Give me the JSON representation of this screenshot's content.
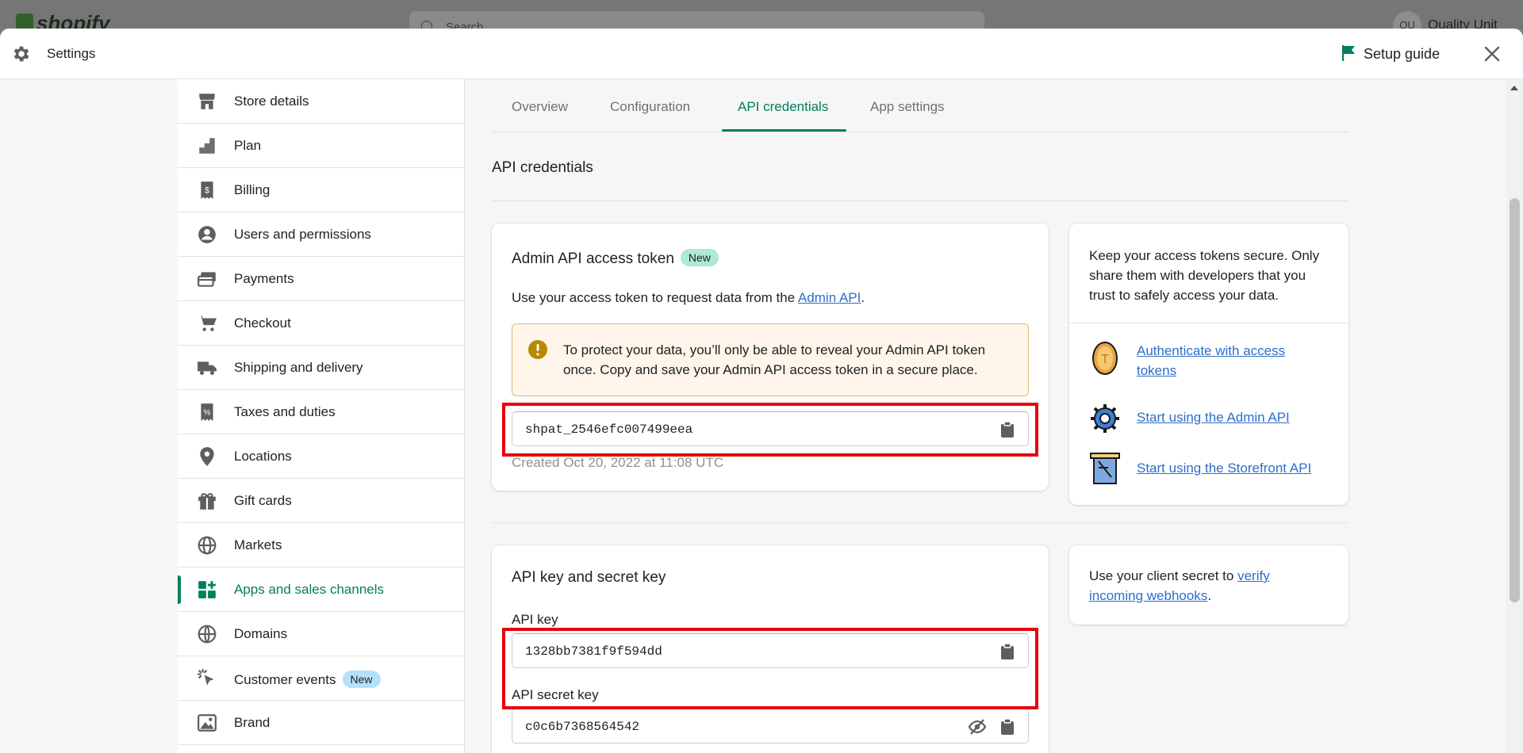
{
  "backdrop": {
    "logo": "shopify",
    "search_placeholder": "Search",
    "user_initials": "QU",
    "user_name": "Quality Unit"
  },
  "modal": {
    "title": "Settings",
    "setup_guide": "Setup guide"
  },
  "sidebar": {
    "items": [
      {
        "label": "Store details",
        "icon": "store-icon"
      },
      {
        "label": "Plan",
        "icon": "plan-icon"
      },
      {
        "label": "Billing",
        "icon": "billing-icon"
      },
      {
        "label": "Users and permissions",
        "icon": "user-icon"
      },
      {
        "label": "Payments",
        "icon": "payments-icon"
      },
      {
        "label": "Checkout",
        "icon": "cart-icon"
      },
      {
        "label": "Shipping and delivery",
        "icon": "truck-icon"
      },
      {
        "label": "Taxes and duties",
        "icon": "tax-icon"
      },
      {
        "label": "Locations",
        "icon": "location-icon"
      },
      {
        "label": "Gift cards",
        "icon": "gift-icon"
      },
      {
        "label": "Markets",
        "icon": "globe-icon"
      },
      {
        "label": "Apps and sales channels",
        "icon": "apps-icon",
        "active": true
      },
      {
        "label": "Domains",
        "icon": "domains-icon"
      },
      {
        "label": "Customer events",
        "icon": "cursor-icon",
        "badge": "New"
      },
      {
        "label": "Brand",
        "icon": "brand-icon"
      }
    ]
  },
  "tabs": [
    {
      "label": "Overview"
    },
    {
      "label": "Configuration"
    },
    {
      "label": "API credentials",
      "active": true
    },
    {
      "label": "App settings"
    }
  ],
  "page": {
    "heading": "API credentials"
  },
  "admin_token_card": {
    "title": "Admin API access token",
    "badge": "New",
    "desc_prefix": "Use your access token to request data from the ",
    "desc_link": "Admin API",
    "desc_suffix": ".",
    "warning": "To protect your data, you’ll only be able to reveal your Admin API token once. Copy and save your Admin API access token in a secure place.",
    "token": "shpat_2546efc007499eea",
    "created": "Created Oct 20, 2022 at 11:08 UTC"
  },
  "resources_card": {
    "text": "Keep your access tokens secure. Only share them with developers that you trust to safely access your data.",
    "links": [
      {
        "label": "Authenticate with access tokens",
        "icon": "coin-icon"
      },
      {
        "label": "Start using the Admin API",
        "icon": "cog-icon"
      },
      {
        "label": "Start using the Storefront API",
        "icon": "scroll-icon"
      }
    ]
  },
  "api_key_card": {
    "title": "API key and secret key",
    "api_key_label": "API key",
    "api_key": "1328bb7381f9f594dd",
    "secret_label": "API secret key",
    "secret": "c0c6b7368564542"
  },
  "webhooks_card": {
    "prefix": "Use your client secret to ",
    "link": "verify incoming webhooks",
    "suffix": "."
  },
  "colors": {
    "accent": "#008060",
    "highlight": "#e8000b",
    "link": "#2c6ecb"
  }
}
